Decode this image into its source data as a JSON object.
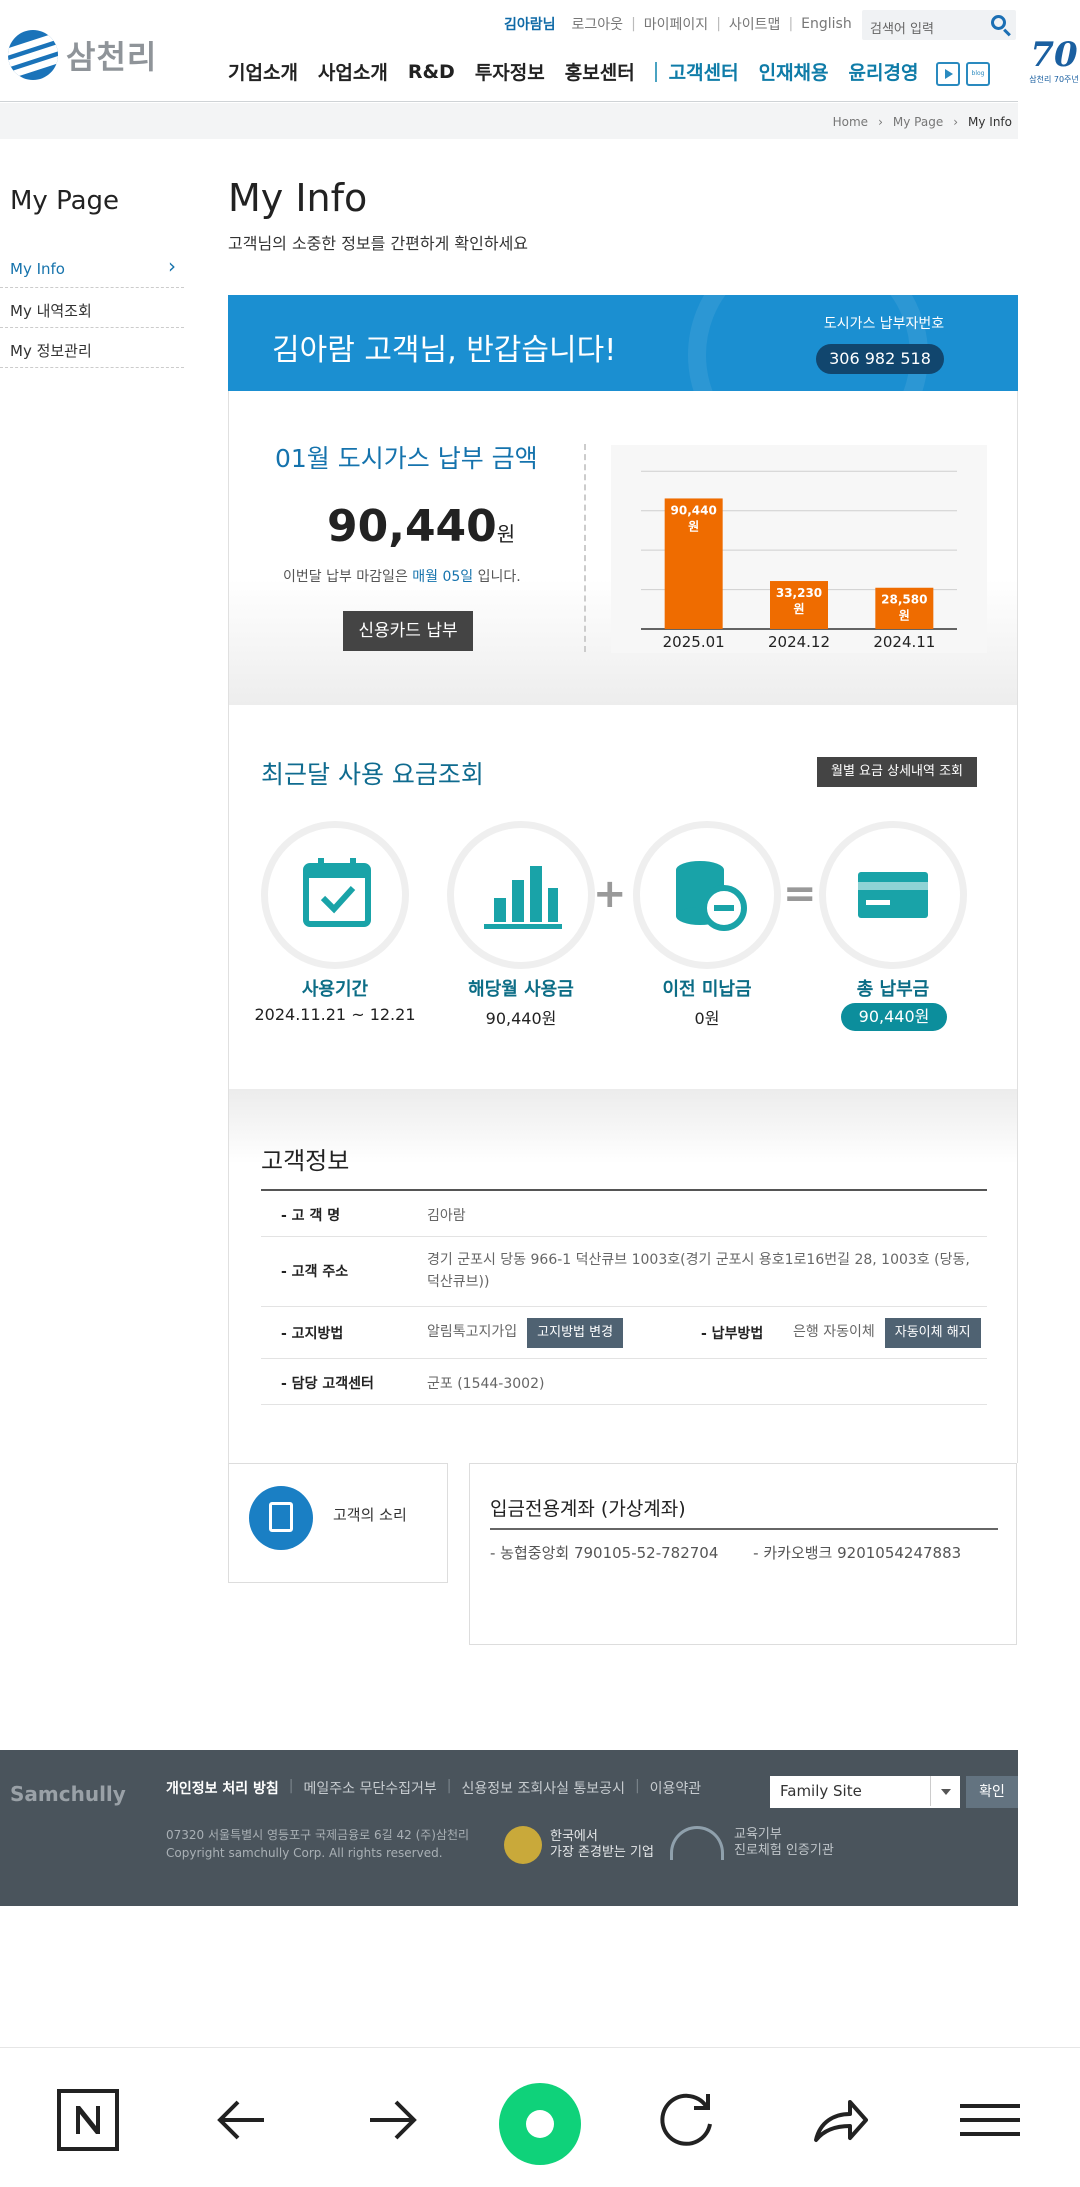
{
  "header": {
    "logo_text": "삼천리",
    "util": {
      "user": "김아람님",
      "logout": "로그아웃",
      "mypage": "마이페이지",
      "sitemap": "사이트맵",
      "english": "English"
    },
    "search_placeholder": "검색어 입력",
    "nav": [
      "기업소개",
      "사업소개",
      "R&D",
      "투자정보",
      "홍보센터",
      "고객센터",
      "인재채용",
      "윤리경영"
    ],
    "anniversary": {
      "number": "70",
      "caption": "삼천리 70주년"
    }
  },
  "breadcrumb": [
    "Home",
    "My Page",
    "My Info"
  ],
  "sidebar": {
    "title": "My Page",
    "items": [
      "My Info",
      "My 내역조회",
      "My 정보관리"
    ]
  },
  "main": {
    "title": "My Info",
    "subtitle": "고객님의 소중한 정보를 간편하게 확인하세요"
  },
  "welcome": {
    "greeting": "김아람 고객님, 반갑습니다!",
    "payer_label": "도시가스 납부자번호",
    "payer_number": "306 982 518"
  },
  "bill": {
    "title": "01월 도시가스 납부 금액",
    "amount": "90,440",
    "unit": "원",
    "due_prefix": "이번달 납부 마감일은",
    "due_day": "매월 05일",
    "due_suffix": "입니다.",
    "pay_button": "신용카드 납부"
  },
  "chart_data": {
    "type": "bar",
    "categories": [
      "2025.01",
      "2024.12",
      "2024.11"
    ],
    "values": [
      90440,
      33230,
      28580
    ],
    "value_labels": [
      "90,440",
      "33,230",
      "28,580"
    ],
    "unit_label": "원",
    "ylim": [
      0,
      115000
    ],
    "grid": true,
    "bar_color": "#ef6c00"
  },
  "usage": {
    "title": "최근달 사용 요금조회",
    "detail_button": "월별 요금 상세내역 조회",
    "items": [
      {
        "label": "사용기간",
        "value": "2024.11.21 ~ 12.21",
        "icon": "calendar-check-icon"
      },
      {
        "label": "해당월 사용금",
        "value": "90,440원",
        "icon": "bar-chart-icon"
      },
      {
        "label": "이전 미납금",
        "value": "0원",
        "icon": "coin-stack-minus-icon"
      },
      {
        "label": "총 납부금",
        "value": "90,440원",
        "icon": "credit-card-icon"
      }
    ],
    "accent": "#19a3a8"
  },
  "customer": {
    "title": "고객정보",
    "name_label": "- 고 객 명",
    "name_value": "김아람",
    "address_label": "- 고객 주소",
    "address_value": "경기 군포시 당동 966-1 덕산큐브 1003호(경기 군포시 용호1로16번길 28, 1003호 (당동, 덕산큐브))",
    "notice_label": "- 고지방법",
    "notice_value": "알림톡고지가입",
    "notice_button": "고지방법 변경",
    "payment_label": "- 납부방법",
    "payment_value": "은행 자동이체",
    "payment_button": "자동이체 해지",
    "center_label": "- 담당 고객센터",
    "center_value": "군포 (1544-3002)"
  },
  "voice": {
    "label": "고객의 소리"
  },
  "account": {
    "title": "입금전용계좌 (가상계좌)",
    "bank1": "- 농협중앙회  790105-52-782704",
    "bank2": "- 카카오뱅크  9201054247883"
  },
  "footer": {
    "logo": "Samchully",
    "links": [
      "개인정보 처리 방침",
      "메일주소 무단수집거부",
      "신용정보 조회사실 통보공시",
      "이용약관"
    ],
    "address": "07320 서울특별시 영등포구 국제금융로 6길 42 (주)삼천리",
    "copyright": "Copyright samchully Corp. All rights reserved.",
    "family_site": "Family Site",
    "confirm": "확인",
    "award1_line1": "한국에서",
    "award1_line2": "가장 존경받는 기업",
    "award2_line1": "교육기부",
    "award2_line2": "진로체험 인증기관"
  }
}
